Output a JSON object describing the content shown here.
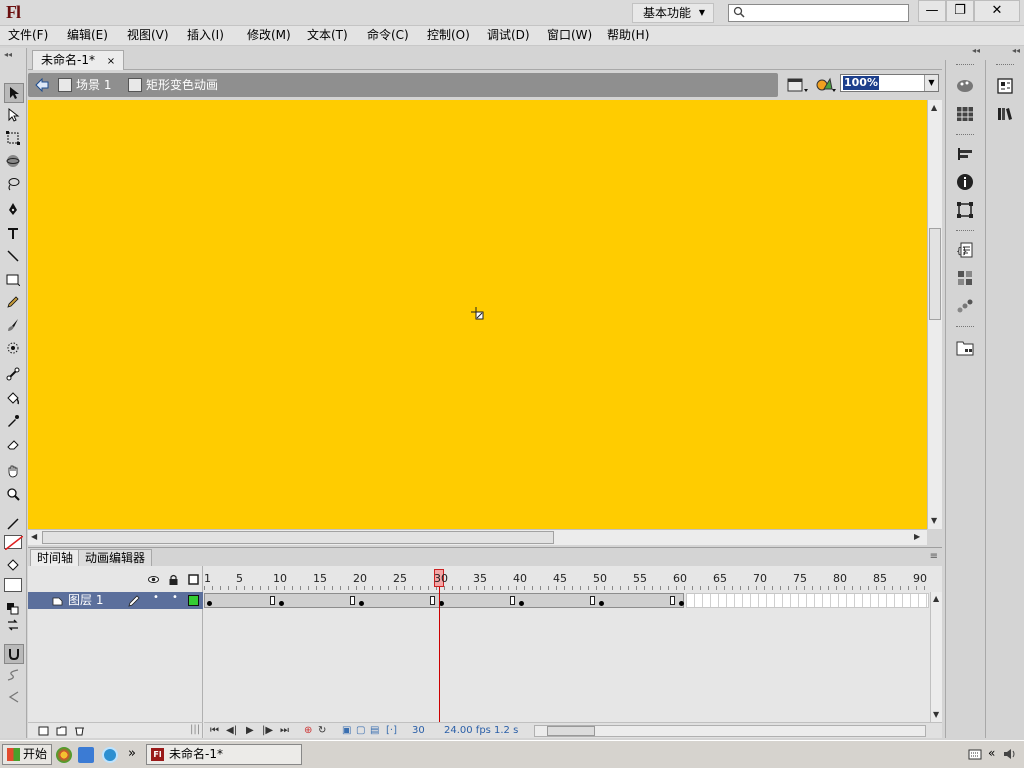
{
  "app": {
    "logo": "Fl"
  },
  "titlebar": {
    "workspace": "基本功能",
    "search_placeholder": "",
    "minimize": "—",
    "restore": "❐",
    "close": "✕"
  },
  "menu": [
    "文件(F)",
    "编辑(E)",
    "视图(V)",
    "插入(I)",
    "修改(M)",
    "文本(T)",
    "命令(C)",
    "控制(O)",
    "调试(D)",
    "窗口(W)",
    "帮助(H)"
  ],
  "document": {
    "tab_title": "未命名-1*",
    "tab_close": "×"
  },
  "editbar": {
    "scene": "场景 1",
    "symbol": "矩形变色动画",
    "zoom": "100%"
  },
  "stage": {
    "color": "#ffcc00"
  },
  "timeline": {
    "tabs": [
      "时间轴",
      "动画编辑器"
    ],
    "layer_name": "图层 1",
    "layer_color": "#33cc33",
    "ruler_labels": [
      "1",
      "5",
      "10",
      "15",
      "20",
      "25",
      "30",
      "35",
      "40",
      "45",
      "50",
      "55",
      "60",
      "65",
      "70",
      "75",
      "80",
      "85",
      "90"
    ],
    "current_frame": "30",
    "total_frames": 60,
    "keyframes": [
      1,
      10,
      20,
      30,
      40,
      50,
      60
    ],
    "status": {
      "frame": "30",
      "fps": "24.00 fps",
      "time": "1.2 s"
    }
  },
  "taskbar": {
    "start": "开始",
    "task_item": "未命名-1*",
    "task_icon": "Fl",
    "more": "»"
  }
}
